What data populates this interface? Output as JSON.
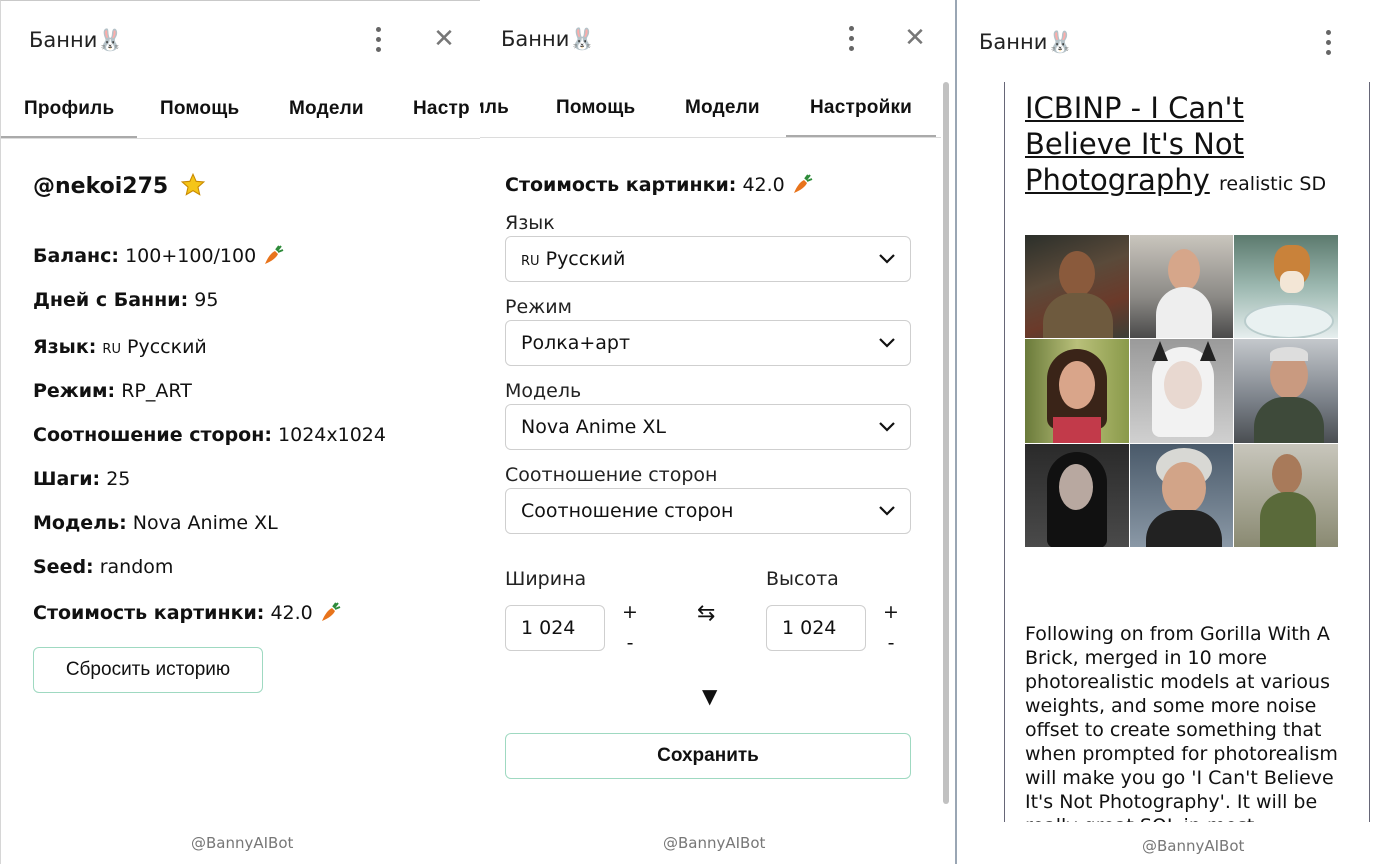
{
  "panel1": {
    "title": "Банни🐰",
    "tabs": [
      "Профиль",
      "Помощь",
      "Модели",
      "Настр"
    ],
    "username": "@nekoi275",
    "rows": [
      {
        "label": "Баланс:",
        "value": "100+100/100"
      },
      {
        "label": "Дней с Банни:",
        "value": "95"
      },
      {
        "label": "Язык:",
        "flag": "RU",
        "value": "Русский"
      },
      {
        "label": "Режим:",
        "value": "RP_ART"
      },
      {
        "label": "Соотношение сторон:",
        "value": "1024x1024"
      },
      {
        "label": "Шаги:",
        "value": "25"
      },
      {
        "label": "Модель:",
        "value": "Nova Anime XL"
      },
      {
        "label": "Seed:",
        "value": "random"
      },
      {
        "label": "Стоимость картинки:",
        "value": "42.0"
      }
    ],
    "reset_button": "Сбросить историю",
    "footer": "@BannyAIBot"
  },
  "panel2": {
    "title": "Банни🐰",
    "tabs": [
      "иль",
      "Помощь",
      "Модели",
      "Настройки"
    ],
    "cost_label": "Стоимость картинки:",
    "cost_value": "42.0",
    "language": {
      "label": "Язык",
      "flag": "RU",
      "value": "Русский"
    },
    "mode": {
      "label": "Режим",
      "value": "Ролка+арт"
    },
    "model": {
      "label": "Модель",
      "value": "Nova Anime XL"
    },
    "aspect": {
      "label": "Соотношение сторон",
      "value": "Соотношение сторон"
    },
    "width": {
      "label": "Ширина",
      "value": "1 024"
    },
    "height": {
      "label": "Высота",
      "value": "1 024"
    },
    "plus": "+",
    "minus": "-",
    "swap_icon": "⇆",
    "expand_icon": "▼",
    "save_button": "Сохранить",
    "footer": "@BannyAIBot"
  },
  "panel3": {
    "title": "Банни🐰",
    "model_title": "ICBINP - I Can't Believe It's Not Photography",
    "model_tag": "realistic SD",
    "description": " Following on from Gorilla With A Brick, merged in 10 more photorealistic models at various weights, and some more noise offset to create something that when prompted for photorealism will make you go 'I Can't Believe It's Not Photography'. It will be really great SQL in most",
    "footer": "@BannyAIBot"
  },
  "colors": {
    "accent_border": "#9fd9c1",
    "carrot": "#e8741c",
    "star": "#f5c518"
  }
}
